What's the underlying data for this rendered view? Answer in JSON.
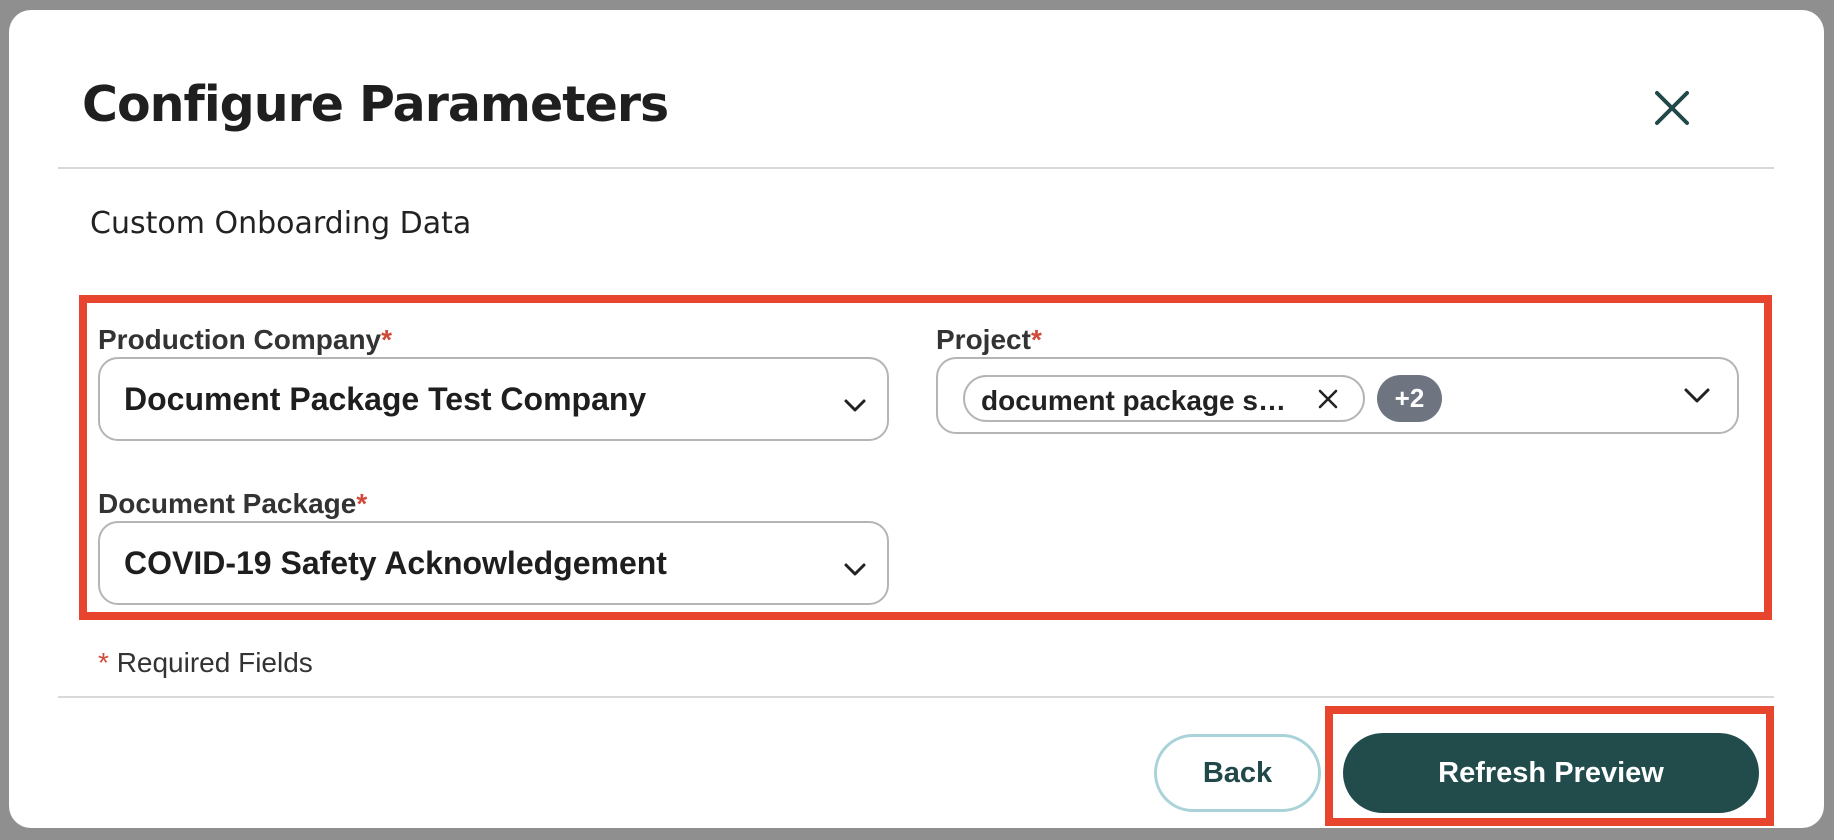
{
  "dialog": {
    "title": "Configure Parameters",
    "section_title": "Custom Onboarding Data",
    "required_marker": "*",
    "required_note": "Required Fields"
  },
  "fields": {
    "production_company": {
      "label": "Production Company",
      "value": "Document Package Test Company"
    },
    "project": {
      "label": "Project",
      "chip": "document package s…",
      "more_count": "+2"
    },
    "document_package": {
      "label": "Document Package",
      "value": "COVID-19 Safety Acknowledgement"
    }
  },
  "footer": {
    "back_label": "Back",
    "refresh_label": "Refresh Preview"
  },
  "icons": {
    "close": "close-icon",
    "dropdown": "chevron-down-icon",
    "chip_remove": "close-icon"
  },
  "colors": {
    "primary": "#224c4c",
    "highlight": "#e8452f",
    "required": "#d04a3a",
    "badge": "#6e7580"
  }
}
